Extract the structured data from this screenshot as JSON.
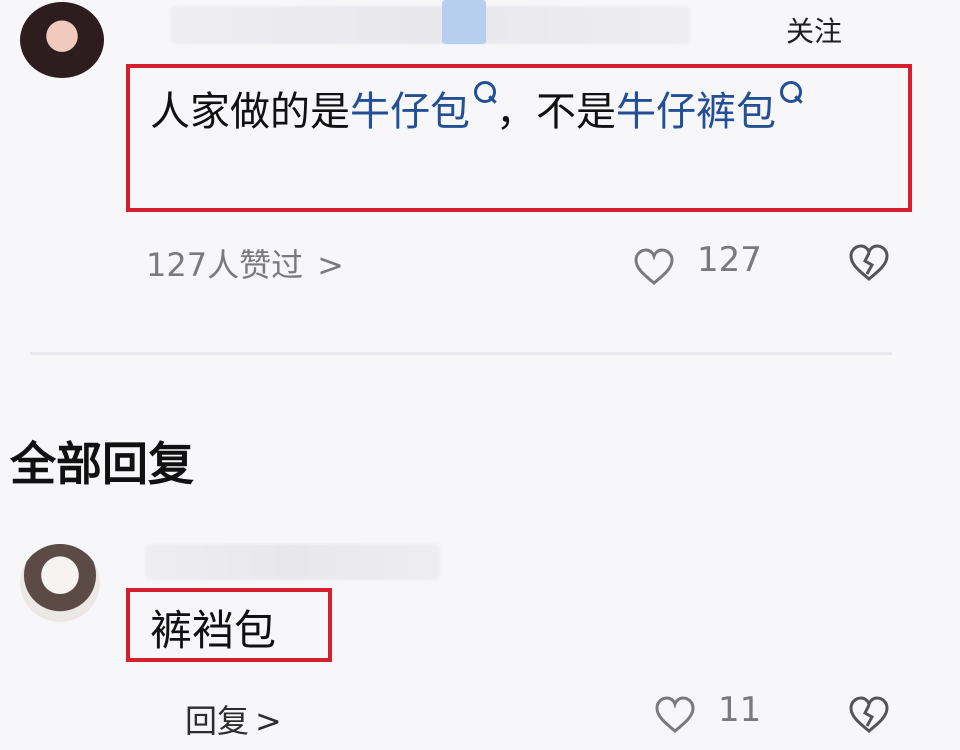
{
  "comment": {
    "follow_label": "关注",
    "text_part1": "人家做的是",
    "keyword1": "牛仔包",
    "text_part2": "，不是",
    "keyword2": "牛仔裤包",
    "liked_by": "127人赞过",
    "liked_chevron": ">",
    "like_count": "127"
  },
  "replies_section": {
    "title": "全部回复"
  },
  "reply": {
    "text": "裤裆包",
    "reply_label": "回复",
    "reply_chevron": ">",
    "like_count": "11"
  },
  "colors": {
    "highlight_border": "#d61f2c",
    "keyword_blue": "#234f96",
    "meta_gray": "#7a7a7a",
    "background": "#f7f7fa"
  },
  "icons": {
    "like": "heart-outline-icon",
    "dislike": "broken-heart-icon",
    "search": "magnifier-icon"
  }
}
